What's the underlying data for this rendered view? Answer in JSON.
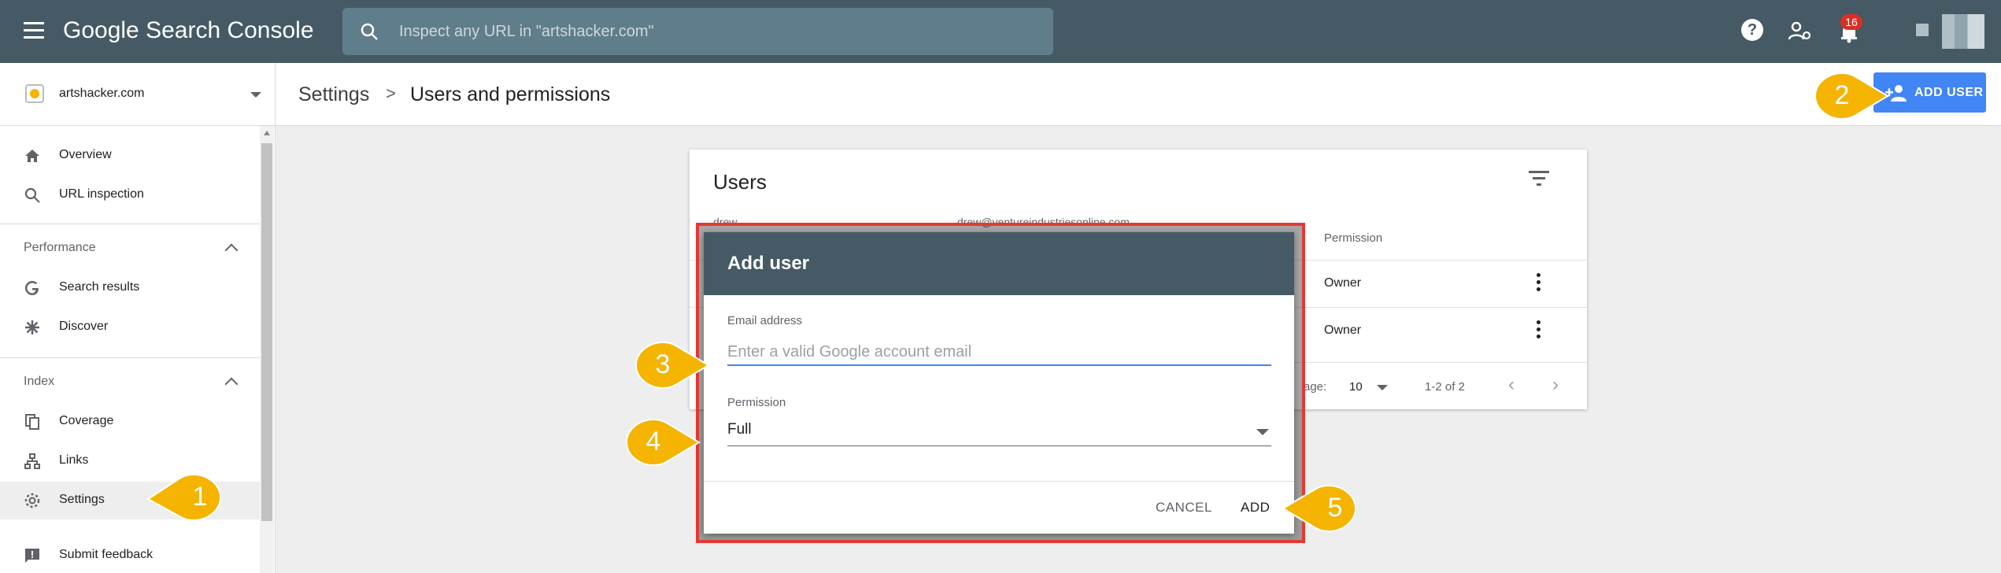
{
  "topbar": {
    "app_name": "Google Search Console",
    "search_placeholder": "Inspect any URL in \"artshacker.com\"",
    "notification_count": "16",
    "icons": [
      "menu-icon",
      "search-icon",
      "help-icon",
      "manage-account-icon",
      "bell-icon",
      "apps-icon",
      "avatar"
    ]
  },
  "property": {
    "name": "artshacker.com"
  },
  "breadcrumb": {
    "parent": "Settings",
    "separator": ">",
    "current": "Users and permissions"
  },
  "toolbar": {
    "add_user_label": "ADD USER"
  },
  "sidebar": {
    "items": [
      {
        "label": "Overview",
        "icon": "home-icon"
      },
      {
        "label": "URL inspection",
        "icon": "search-icon"
      }
    ],
    "performance": {
      "header": "Performance",
      "items": [
        {
          "label": "Search results",
          "icon": "google-g-icon"
        },
        {
          "label": "Discover",
          "icon": "asterisk-icon"
        }
      ]
    },
    "index": {
      "header": "Index",
      "items": [
        {
          "label": "Coverage",
          "icon": "copy-pages-icon"
        },
        {
          "label": "Links",
          "icon": "sitemap-icon"
        },
        {
          "label": "Settings",
          "icon": "gear-icon",
          "active": true
        }
      ]
    },
    "feedback": {
      "label": "Submit feedback",
      "icon": "feedback-icon"
    }
  },
  "users_card": {
    "title": "Users",
    "partial_row_name": "drew",
    "partial_row_email": "drew@ventureindustriesonline.com",
    "column_permission": "Permission",
    "rows": [
      {
        "permission": "Owner"
      },
      {
        "permission": "Owner"
      }
    ],
    "footer": {
      "rows_per_page_label": "age:",
      "rows_per_page_value": "10",
      "range": "1-2 of 2",
      "prev": "‹",
      "next": "›"
    }
  },
  "dialog": {
    "title": "Add user",
    "email_label": "Email address",
    "email_placeholder": "Enter a valid Google account email",
    "permission_label": "Permission",
    "permission_value": "Full",
    "cancel_label": "CANCEL",
    "add_label": "ADD"
  },
  "callouts": {
    "c1": "1",
    "c2": "2",
    "c3": "3",
    "c4": "4",
    "c5": "5",
    "color": "#f4b400",
    "highlight_color": "#e53935"
  },
  "colors": {
    "topbar": "#455a64",
    "accent": "#4285f4"
  }
}
